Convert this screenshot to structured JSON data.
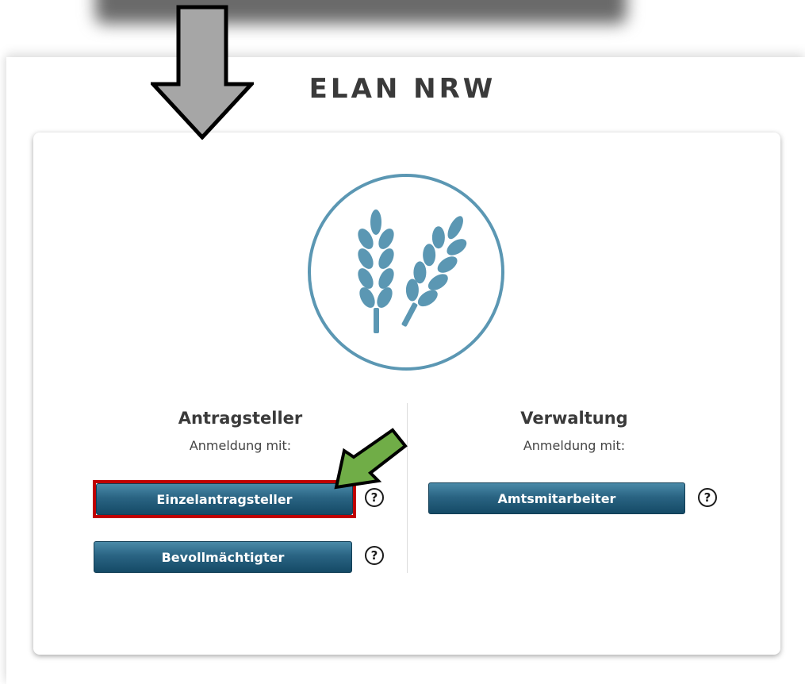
{
  "app": {
    "title": "ELAN NRW"
  },
  "logo": {
    "icon": "wheat-ears-icon",
    "color": "#5b97b3"
  },
  "applicant": {
    "heading": "Antragsteller",
    "subheading": "Anmeldung mit:",
    "buttons": {
      "individual": "Einzelantragsteller",
      "proxy": "Bevollmächtigter"
    }
  },
  "administration": {
    "heading": "Verwaltung",
    "subheading": "Anmeldung mit:",
    "buttons": {
      "official": "Amtsmitarbeiter"
    }
  },
  "help": {
    "symbol": "?"
  },
  "annotations": {
    "highlight_color": "#c00000",
    "gray_arrow_color": "#a6a6a6",
    "green_arrow_color": "#70ad47"
  }
}
